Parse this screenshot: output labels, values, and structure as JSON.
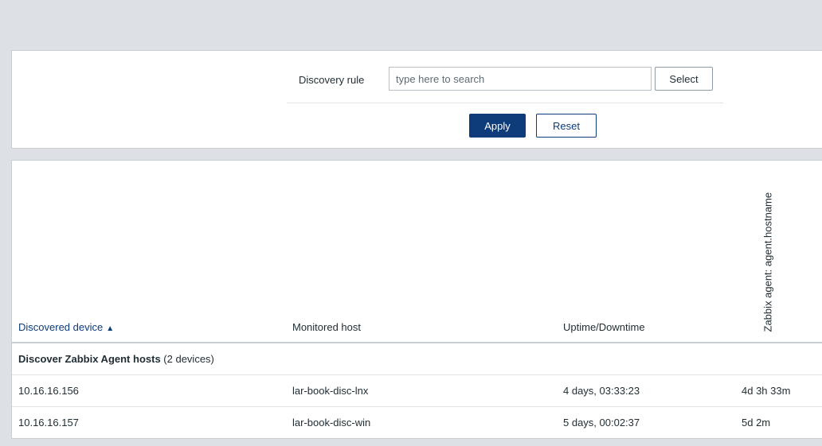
{
  "filter": {
    "label": "Discovery rule",
    "placeholder": "type here to search",
    "value": "",
    "select_label": "Select",
    "apply_label": "Apply",
    "reset_label": "Reset"
  },
  "table": {
    "columns": {
      "device": "Discovered device",
      "device_sort": "▲",
      "host": "Monitored host",
      "uptime": "Uptime/Downtime",
      "agent": "Zabbix agent: agent.hostname"
    },
    "group": {
      "name": "Discover Zabbix Agent hosts",
      "count": "(2 devices)"
    },
    "rows": [
      {
        "device": "10.16.16.156",
        "host": "lar-book-disc-lnx",
        "uptime": "4 days, 03:33:23",
        "agent": "4d 3h 33m"
      },
      {
        "device": "10.16.16.157",
        "host": "lar-book-disc-win",
        "uptime": "5 days, 00:02:37",
        "agent": "5d 2m"
      }
    ]
  },
  "colors": {
    "accent": "#0e3b7a",
    "background": "#dde1e5"
  }
}
